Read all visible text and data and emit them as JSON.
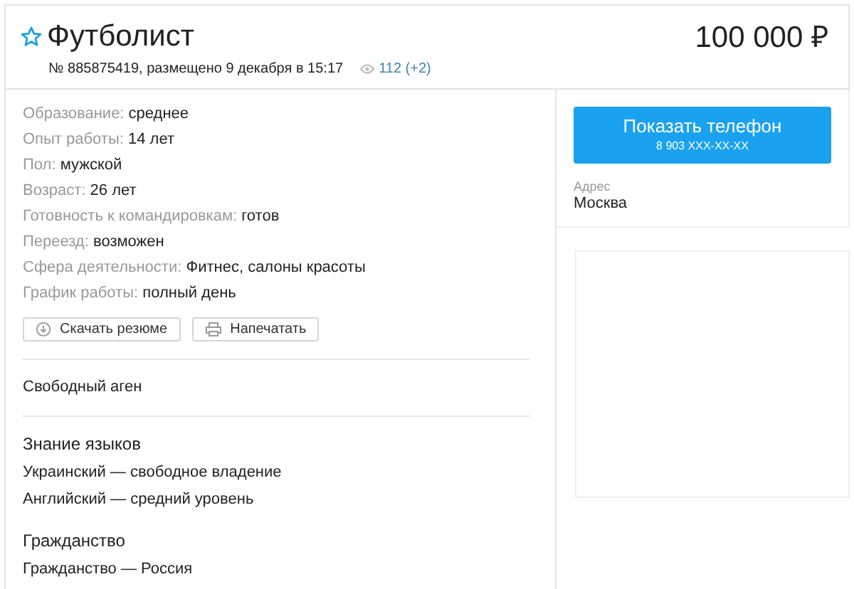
{
  "listing": {
    "title": "Футболист",
    "favorite": false,
    "price": "100 000 ₽",
    "meta": "№ 885875419, размещено 9 декабря в 15:17",
    "views": "112 (+2)"
  },
  "details": [
    {
      "label": "Образование:",
      "value": "среднее"
    },
    {
      "label": "Опыт работы:",
      "value": "14 лет"
    },
    {
      "label": "Пол:",
      "value": "мужской"
    },
    {
      "label": "Возраст:",
      "value": "26 лет"
    },
    {
      "label": "Готовность к командировкам:",
      "value": "готов"
    },
    {
      "label": "Переезд:",
      "value": "возможен"
    },
    {
      "label": "Сфера деятельности:",
      "value": "Фитнес, салоны красоты"
    },
    {
      "label": "График работы:",
      "value": "полный день"
    }
  ],
  "actions": [
    {
      "kind": "download",
      "label": "Скачать резюме"
    },
    {
      "kind": "print",
      "label": "Напечатать"
    }
  ],
  "description": "Свободный аген",
  "sections": [
    {
      "heading": "Знание языков",
      "lines": [
        "Украинский — свободное владение",
        "Английский — средний уровень"
      ]
    },
    {
      "heading": "Гражданство",
      "lines": [
        "Гражданство — Россия"
      ]
    }
  ],
  "contact": {
    "button": "Показать телефон",
    "phone": "8 903 XXX-XX-XX",
    "address_label": "Адрес",
    "address": "Москва"
  }
}
